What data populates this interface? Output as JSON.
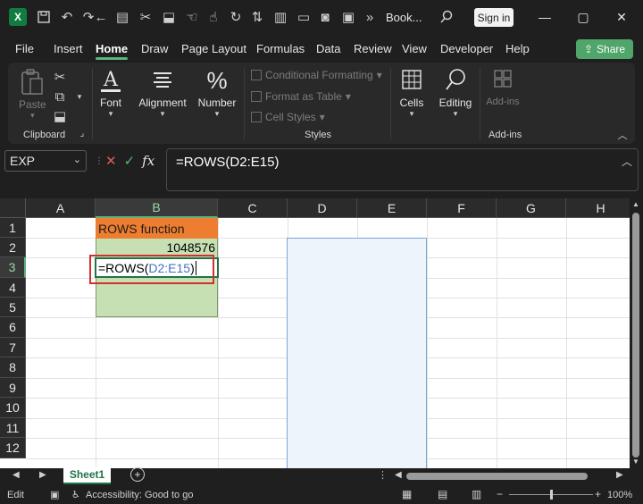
{
  "titlebar": {
    "app_icon": "excel-logo",
    "app_letter": "X",
    "doc_title": "Book...",
    "signin_label": "Sign in",
    "quick_icons": [
      "save-icon",
      "undo-icon",
      "redo-icon",
      "back-icon",
      "clipboard-icon",
      "cut-icon",
      "paint-icon",
      "touch-icon",
      "history-icon",
      "rect-icon",
      "camera-icon",
      "more-icon"
    ],
    "window_controls": [
      "minimize-icon",
      "maximize-icon",
      "close-icon"
    ]
  },
  "tabs": [
    "File",
    "Insert",
    "Home",
    "Draw",
    "Page Layout",
    "Formulas",
    "Data",
    "Review",
    "View",
    "Developer",
    "Help"
  ],
  "active_tab": "Home",
  "share_label": "Share",
  "ribbon": {
    "clipboard": {
      "paste": "Paste",
      "label": "Clipboard"
    },
    "font": "Font",
    "alignment": "Alignment",
    "number": "Number",
    "styles": {
      "conditional": "Conditional Formatting",
      "format_table": "Format as Table",
      "cell_styles": "Cell Styles",
      "label": "Styles"
    },
    "cells": "Cells",
    "editing": "Editing",
    "addins": "Add-ins",
    "addins_group": "Add-ins"
  },
  "formula_bar": {
    "name_box": "EXP",
    "fx": "fx",
    "formula": "=ROWS(D2:E15)"
  },
  "columns": [
    "A",
    "B",
    "C",
    "D",
    "E",
    "F",
    "G",
    "H"
  ],
  "rows": [
    "1",
    "2",
    "3",
    "4",
    "5",
    "6",
    "7",
    "8",
    "9",
    "10",
    "11",
    "12"
  ],
  "cells": {
    "b1": "ROWS function",
    "b2": "1048576",
    "b3_prefix": "=ROWS(",
    "b3_range": "D2:E15",
    "b3_suffix": ")"
  },
  "sheets": [
    "Sheet1"
  ],
  "status": {
    "mode": "Edit",
    "accessibility": "Accessibility: Good to go",
    "zoom": "100%"
  },
  "colors": {
    "accent": "#217346",
    "header_fill": "#ed7d31",
    "block_fill": "#c6e0b4",
    "range_ref": "#4472c4",
    "edit_outline": "#d32f2f"
  }
}
